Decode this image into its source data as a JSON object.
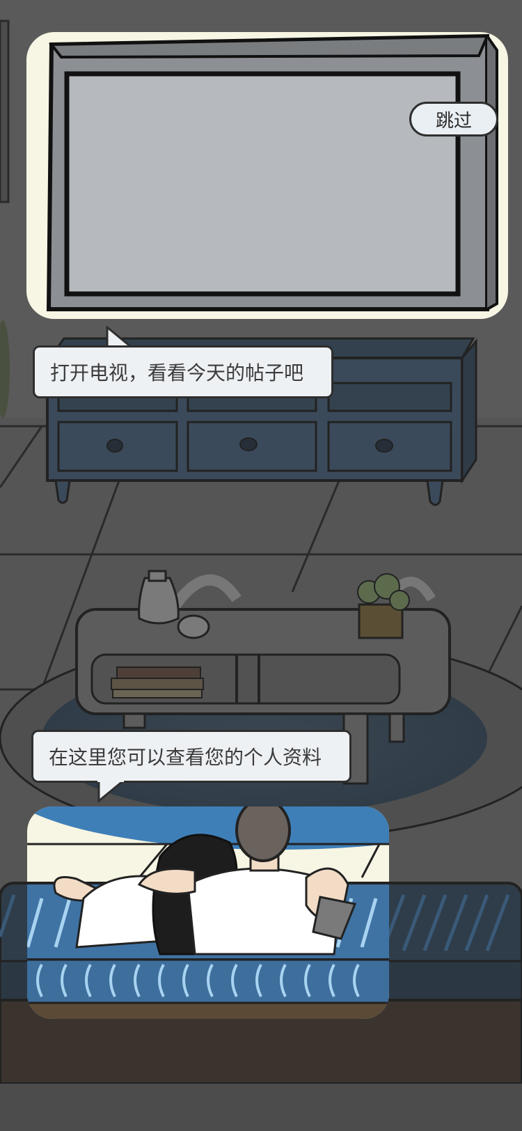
{
  "skip_button": {
    "label": "跳过"
  },
  "tips": [
    {
      "text": "打开电视，看看今天的帖子吧"
    },
    {
      "text": "在这里您可以查看您的个人资料"
    }
  ],
  "colors": {
    "overlay": "#545454",
    "highlight": "#f7f5e3",
    "bubble_bg": "#eef1f4",
    "tv_screen": "#b6babe",
    "cabinet": "#3b4a5a",
    "sofa": "#3f73a4"
  }
}
